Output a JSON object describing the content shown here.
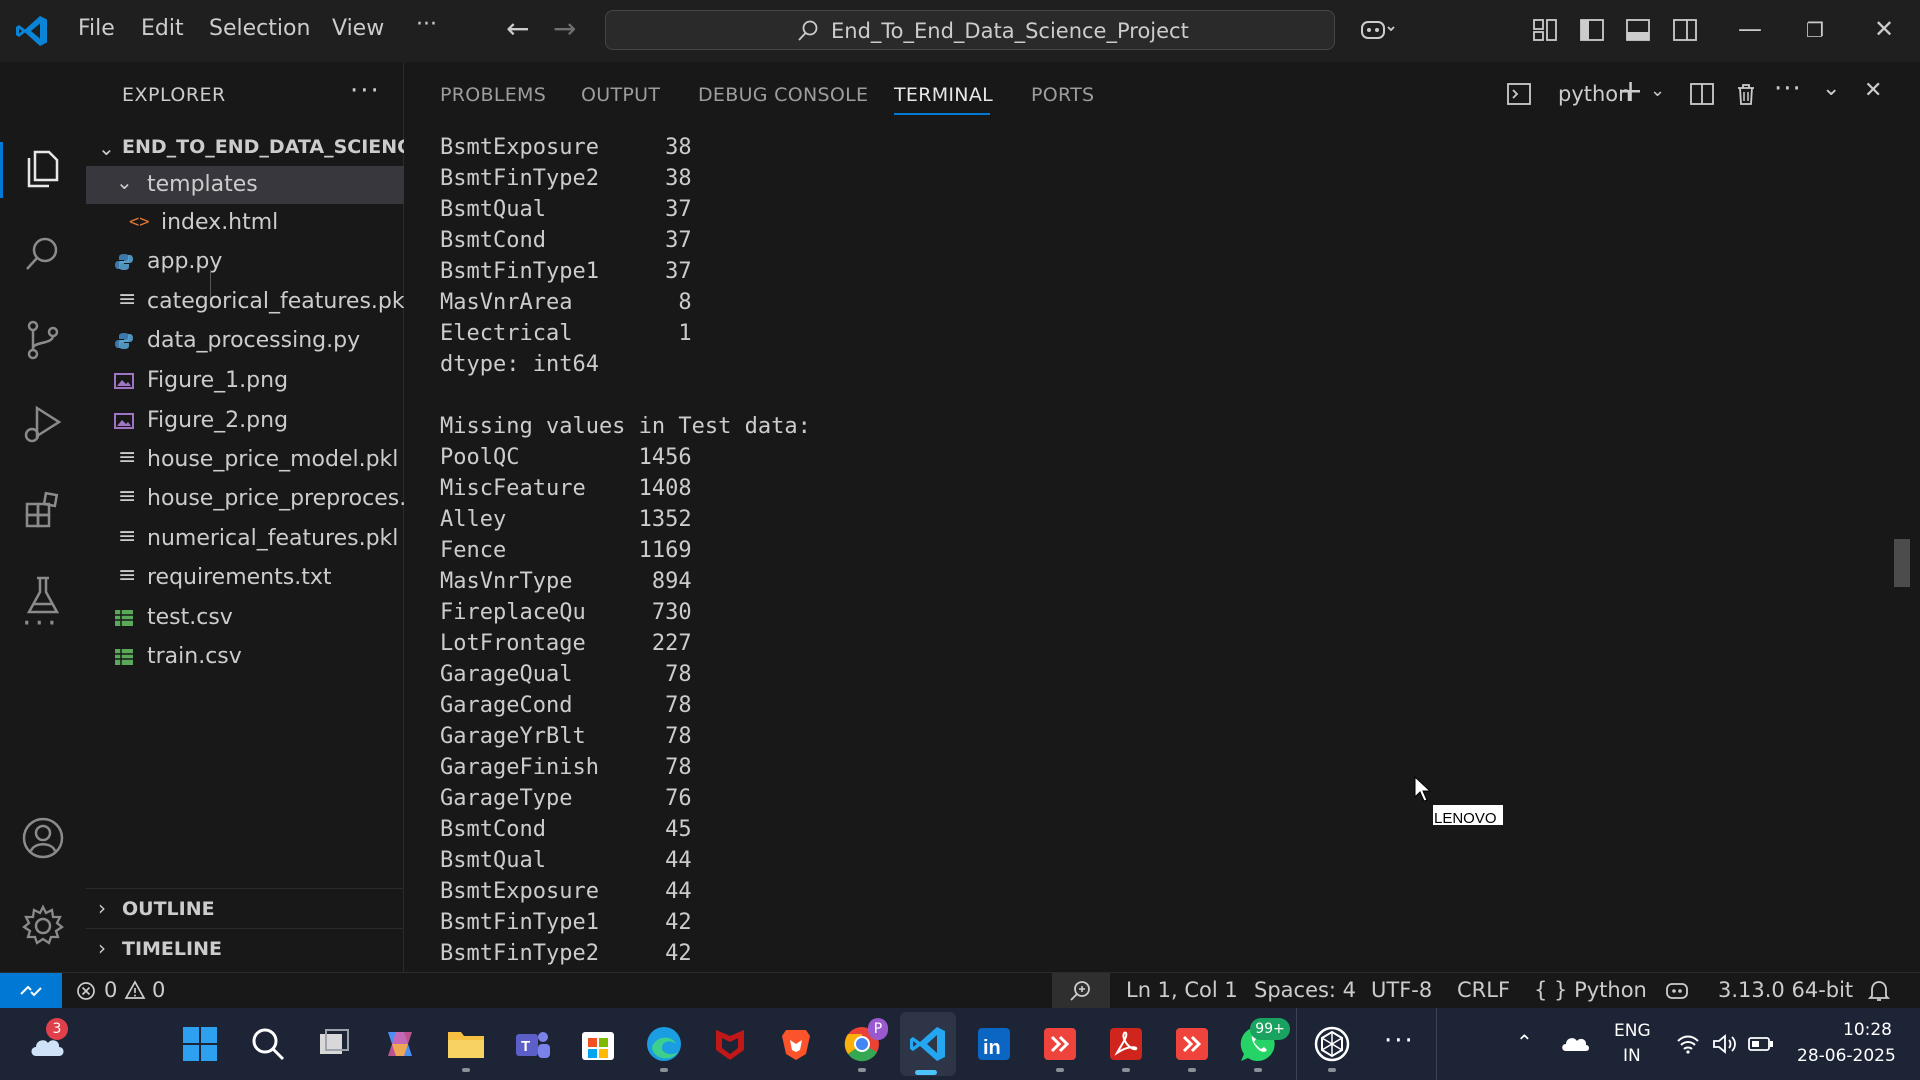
{
  "titlebar": {
    "menu": [
      "File",
      "Edit",
      "Selection",
      "View",
      "···"
    ],
    "search_title": "End_To_End_Data_Science_Project"
  },
  "sidebar": {
    "header": "EXPLORER",
    "root_folder": "END_TO_END_DATA_SCIENC...",
    "files": [
      {
        "name": "templates",
        "icon": "folder-chevron-down-icon"
      },
      {
        "name": "index.html",
        "icon": "html-file-icon"
      },
      {
        "name": "app.py",
        "icon": "python-file-icon"
      },
      {
        "name": "categorical_features.pkl",
        "icon": "generic-file-icon"
      },
      {
        "name": "data_processing.py",
        "icon": "python-file-icon"
      },
      {
        "name": "Figure_1.png",
        "icon": "image-file-icon"
      },
      {
        "name": "Figure_2.png",
        "icon": "image-file-icon"
      },
      {
        "name": "house_price_model.pkl",
        "icon": "generic-file-icon"
      },
      {
        "name": "house_price_preproces...",
        "icon": "generic-file-icon"
      },
      {
        "name": "numerical_features.pkl",
        "icon": "generic-file-icon"
      },
      {
        "name": "requirements.txt",
        "icon": "generic-file-icon"
      },
      {
        "name": "test.csv",
        "icon": "csv-file-icon"
      },
      {
        "name": "train.csv",
        "icon": "csv-file-icon"
      }
    ],
    "outline": "OUTLINE",
    "timeline": "TIMELINE"
  },
  "panel": {
    "tabs": [
      "PROBLEMS",
      "OUTPUT",
      "DEBUG CONSOLE",
      "TERMINAL",
      "PORTS"
    ],
    "active_tab": "TERMINAL",
    "terminal_name": "python",
    "lines": [
      "BsmtExposure     38",
      "BsmtFinType2     38",
      "BsmtQual         37",
      "BsmtCond         37",
      "BsmtFinType1     37",
      "MasVnrArea        8",
      "Electrical        1",
      "dtype: int64",
      "",
      "Missing values in Test data:",
      "PoolQC         1456",
      "MiscFeature    1408",
      "Alley          1352",
      "Fence          1169",
      "MasVnrType      894",
      "FireplaceQu     730",
      "LotFrontage     227",
      "GarageQual       78",
      "GarageCond       78",
      "GarageYrBlt      78",
      "GarageFinish     78",
      "GarageType       76",
      "BsmtCond         45",
      "BsmtQual         44",
      "BsmtExposure     44",
      "BsmtFinType1     42",
      "BsmtFinType2     42"
    ],
    "overlay_label": "LENOVO"
  },
  "statusbar": {
    "errors": "0",
    "warnings": "0",
    "position": "Ln 1, Col 1",
    "spaces": "Spaces: 4",
    "encoding": "UTF-8",
    "eol": "CRLF",
    "language": "{ } Python",
    "interpreter": "3.13.0 64-bit"
  },
  "taskbar": {
    "weather_badge": "3",
    "whatsapp_badge": "99+",
    "chrome_badge": "P",
    "lang_top": "ENG",
    "lang_bottom": "IN",
    "time": "10:28",
    "date": "28-06-2025"
  },
  "colors": {
    "accent": "#0078d4",
    "background": "#181818",
    "titlebar": "#1f1f1f",
    "taskbar": "#1c2436"
  }
}
